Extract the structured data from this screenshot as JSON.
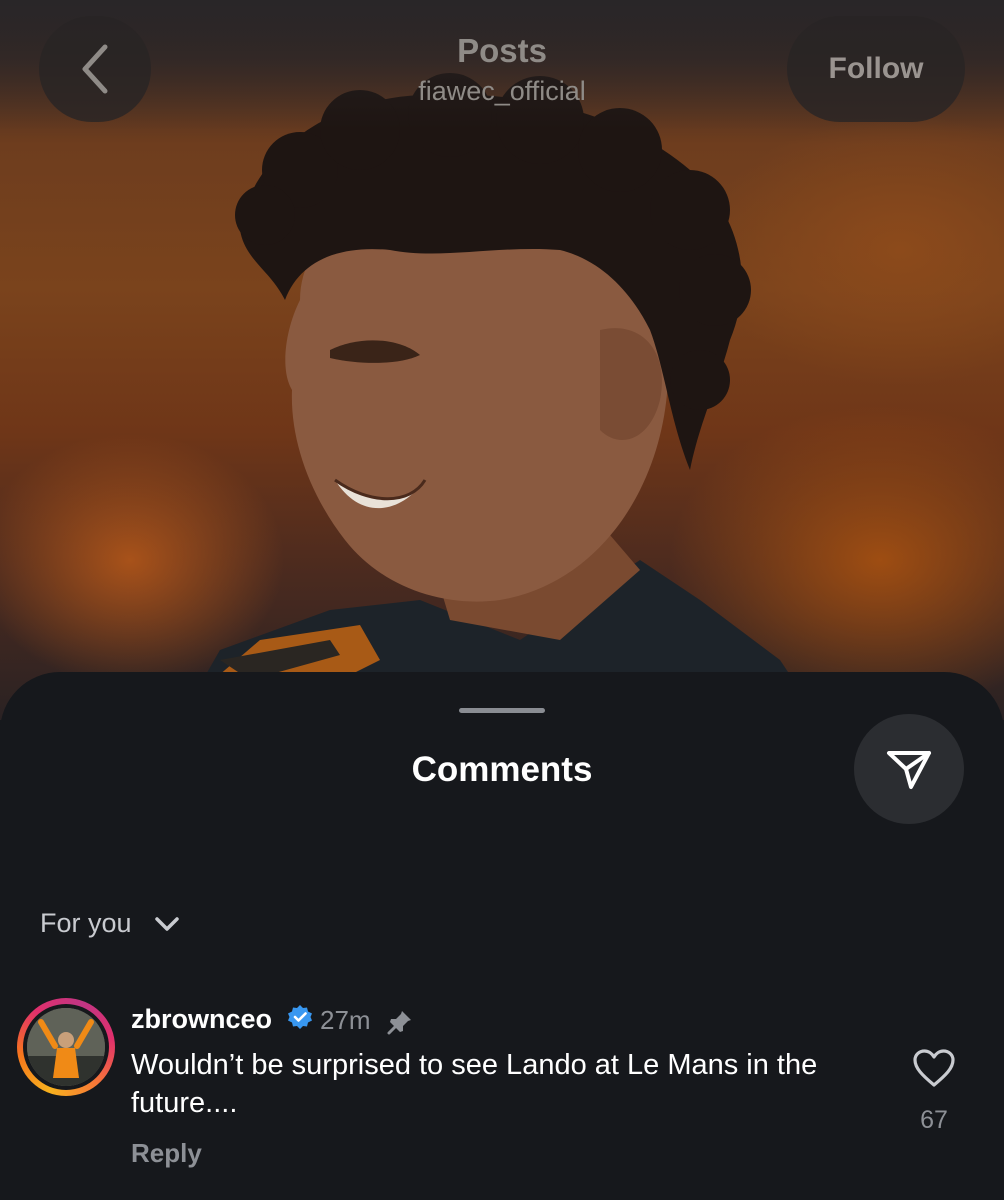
{
  "header": {
    "title": "Posts",
    "subtitle": "fiawec_official",
    "follow_label": "Follow",
    "back_icon": "chevron-left-icon"
  },
  "sheet": {
    "title": "Comments",
    "share_icon": "send-icon",
    "sort_label": "For you",
    "sort_icon": "chevron-down-icon"
  },
  "comment": {
    "username": "zbrownceo",
    "verified": true,
    "time": "27m",
    "pinned": true,
    "text": "Wouldn’t be surprised to see Lando at Le Mans in the future....",
    "reply_label": "Reply",
    "like_count": "67"
  },
  "colors": {
    "sheet_bg": "#16181c",
    "verified_blue": "#3897f0",
    "text_muted": "#8d9096"
  }
}
